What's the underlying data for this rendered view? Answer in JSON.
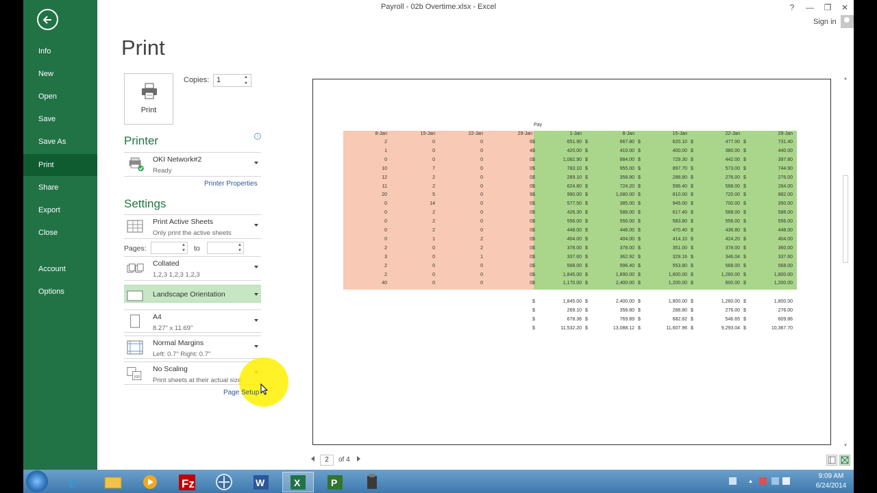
{
  "window": {
    "title": "Payroll - 02b Overtime.xlsx - Excel",
    "help": "?",
    "minimize": "—",
    "restore": "❐",
    "close": "✕",
    "sign_in": "Sign in"
  },
  "nav": {
    "items": [
      "Info",
      "New",
      "Open",
      "Save",
      "Save As",
      "Print",
      "Share",
      "Export",
      "Close",
      "Account",
      "Options"
    ],
    "active": "Print"
  },
  "print": {
    "title": "Print",
    "button_label": "Print",
    "copies_label": "Copies:",
    "copies_value": "1"
  },
  "printer": {
    "heading": "Printer",
    "name": "OKI Network#2",
    "status": "Ready",
    "properties_link": "Printer Properties"
  },
  "settings": {
    "heading": "Settings",
    "what": {
      "title": "Print Active Sheets",
      "desc": "Only print the active sheets"
    },
    "pages_label": "Pages:",
    "to_label": "to",
    "collate": {
      "title": "Collated",
      "desc": "1,2,3    1,2,3    1,2,3"
    },
    "orientation": {
      "title": "Landscape Orientation"
    },
    "paper": {
      "title": "A4",
      "desc": "8.27\" x 11.69\""
    },
    "margins": {
      "title": "Normal Margins",
      "desc": "Left: 0.7\"    Right: 0.7\""
    },
    "scaling": {
      "title": "No Scaling",
      "desc": "Print sheets at their actual size"
    },
    "page_setup_link": "Page Setup"
  },
  "preview": {
    "pay_label": "Pay",
    "hours_headers": [
      "8-Jan",
      "15-Jan",
      "22-Jan",
      "29-Jan"
    ],
    "pay_headers": [
      "1-Jan",
      "8-Jan",
      "15-Jan",
      "22-Jan",
      "29-Jan"
    ],
    "hours_rows": [
      [
        "2",
        "0",
        "0",
        "6"
      ],
      [
        "1",
        "0",
        "0",
        "4"
      ],
      [
        "0",
        "0",
        "0",
        "0"
      ],
      [
        "10",
        "7",
        "0",
        "0"
      ],
      [
        "12",
        "2",
        "0",
        "0"
      ],
      [
        "11",
        "2",
        "0",
        "0"
      ],
      [
        "20",
        "5",
        "0",
        "9"
      ],
      [
        "0",
        "14",
        "0",
        "0"
      ],
      [
        "0",
        "2",
        "0",
        "0"
      ],
      [
        "0",
        "2",
        "0",
        "0"
      ],
      [
        "0",
        "2",
        "0",
        "0"
      ],
      [
        "0",
        "1",
        "2",
        "0"
      ],
      [
        "2",
        "0",
        "2",
        "0"
      ],
      [
        "3",
        "0",
        "1",
        "0"
      ],
      [
        "2",
        "0",
        "0",
        "0"
      ],
      [
        "2",
        "0",
        "0",
        "0"
      ],
      [
        "40",
        "0",
        "0",
        "0"
      ]
    ],
    "pay_rows": [
      [
        "651.90",
        "667.80",
        "620.10",
        "477.00",
        "731.40"
      ],
      [
        "420.00",
        "410.00",
        "400.00",
        "380.00",
        "440.00"
      ],
      [
        "1,082.90",
        "884.00",
        "729.30",
        "442.00",
        "397.80"
      ],
      [
        "783.10",
        "955.00",
        "897.70",
        "573.00",
        "744.90"
      ],
      [
        "269.10",
        "358.80",
        "288.80",
        "276.00",
        "276.00"
      ],
      [
        "624.80",
        "724.20",
        "596.40",
        "568.00",
        "284.00"
      ],
      [
        "990.00",
        "1,080.00",
        "810.00",
        "720.00",
        "882.00"
      ],
      [
        "577.50",
        "385.00",
        "945.00",
        "700.00",
        "350.00"
      ],
      [
        "426.30",
        "588.00",
        "617.40",
        "588.00",
        "588.00"
      ],
      [
        "556.00",
        "556.00",
        "583.80",
        "556.00",
        "556.00"
      ],
      [
        "448.00",
        "448.00",
        "470.40",
        "436.80",
        "448.00"
      ],
      [
        "404.00",
        "404.00",
        "414.10",
        "424.20",
        "404.00"
      ],
      [
        "378.00",
        "378.00",
        "351.00",
        "378.00",
        "360.00"
      ],
      [
        "337.60",
        "362.92",
        "329.16",
        "346.04",
        "337.60"
      ],
      [
        "568.00",
        "596.40",
        "553.80",
        "568.00",
        "568.00"
      ],
      [
        "1,845.00",
        "1,890.00",
        "1,800.00",
        "1,260.00",
        "1,800.00"
      ],
      [
        "1,170.00",
        "2,400.00",
        "1,200.00",
        "600.00",
        "1,200.00"
      ]
    ],
    "summary_rows": [
      [
        "1,845.00",
        "2,400.00",
        "1,800.00",
        "1,260.00",
        "1,800.00"
      ],
      [
        "269.10",
        "358.80",
        "288.80",
        "276.00",
        "276.00"
      ],
      [
        "678.36",
        "769.89",
        "682.82",
        "546.65",
        "609.86"
      ],
      [
        "11,532.20",
        "13,088.12",
        "11,607.96",
        "9,293.04",
        "10,367.70"
      ]
    ],
    "currency": "$",
    "colors": {
      "hours_fill": "#f8c9b4",
      "pay_fill": "#a9d68a"
    }
  },
  "pager": {
    "current": "2",
    "of_label": "of 4"
  },
  "taskbar": {
    "apps": [
      "internet-explorer",
      "file-explorer",
      "media-player",
      "filezilla",
      "network-app",
      "word",
      "excel",
      "project",
      "tool"
    ],
    "active": "excel",
    "time": "9:09 AM",
    "date": "6/24/2014"
  },
  "accent": "#217346"
}
